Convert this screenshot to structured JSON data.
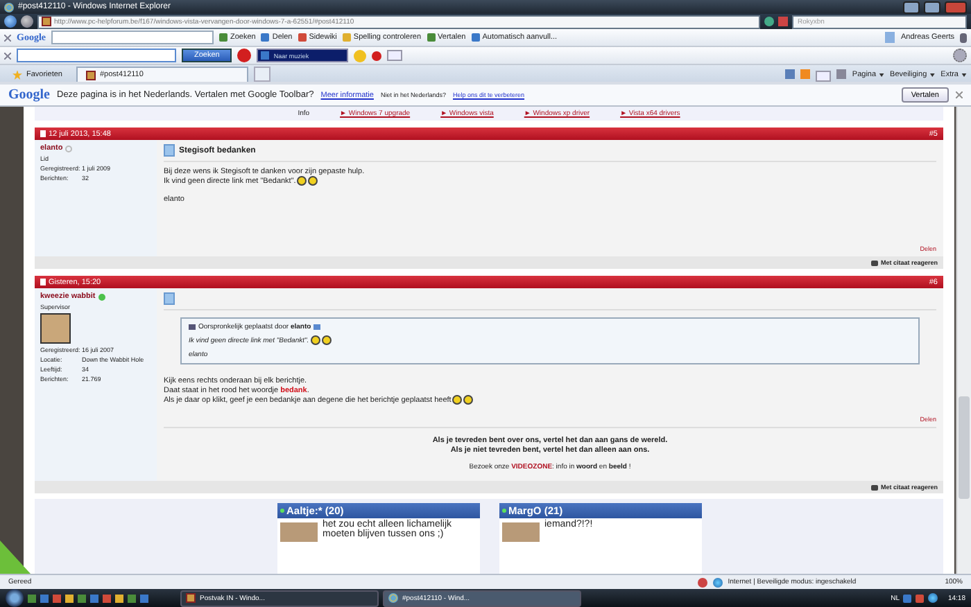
{
  "window": {
    "title": "#post412110 - Windows Internet Explorer"
  },
  "address_bar": {
    "url": "http://www.pc-helpforum.be/f167/windows-vista-vervangen-door-windows-7-a-62551/#post412110",
    "search_placeholder": "Rokyxbn"
  },
  "google_toolbar": {
    "logo": "Google",
    "items": [
      "Zoeken",
      "Delen",
      "Sidewiki",
      "Spelling controleren",
      "Vertalen",
      "Automatisch aanvull..."
    ],
    "account": "Andreas Geerts"
  },
  "second_toolbar": {
    "search_button": "Zoeken",
    "music_field": "Naar muziek"
  },
  "tabs": [
    {
      "label": "Favorieten",
      "kind": "favorites",
      "selected": false
    },
    {
      "label": "#post412110",
      "kind": "page",
      "selected": true
    }
  ],
  "command_bar": [
    "Pagina",
    "Beveiliging",
    "Extra"
  ],
  "translate_bar": {
    "logo": "Google",
    "message": "Deze pagina is in het Nederlands. Vertalen met Google Toolbar?",
    "more_link": "Meer informatie",
    "question": "Niet in het Nederlands?",
    "help_link": "Help ons dit te verbeteren",
    "button": "Vertalen"
  },
  "ad_links": {
    "label": "Info",
    "links": [
      "► Windows 7 upgrade",
      "► Windows vista",
      "► Windows xp driver",
      "► Vista x64 drivers"
    ]
  },
  "posts": [
    {
      "date": "12 juli 2013, 15:48",
      "number": "#5",
      "author": "elanto",
      "online": false,
      "role": "Lid",
      "avatar": false,
      "fields": [
        {
          "label": "Geregistreerd:",
          "value": "1 juli 2009"
        },
        {
          "label": "Berichten:",
          "value": "32"
        }
      ],
      "title": "Stegisoft bedanken",
      "lines": [
        {
          "text": "Bij deze wens ik Stegisoft te danken voor zijn gepaste hulp.",
          "smileys": false
        },
        {
          "text": "Ik vind geen directe link met \"Bedankt\".",
          "smileys": true
        }
      ],
      "signoff": "elanto",
      "share": "Delen",
      "reply": "Met citaat reageren"
    },
    {
      "date": "Gisteren, 15:20",
      "number": "#6",
      "author": "kweezie wabbit",
      "online": true,
      "role": "Supervisor",
      "avatar": true,
      "fields": [
        {
          "label": "Geregistreerd:",
          "value": "16 juli 2007"
        },
        {
          "label": "Locatie:",
          "value": "Down the Wabbit Hole"
        },
        {
          "label": "Leeftijd:",
          "value": "34"
        },
        {
          "label": "Berichten:",
          "value": "21.769"
        }
      ],
      "quote": {
        "prefix": "Oorspronkelijk geplaatst door",
        "author": "elanto",
        "text": "Ik vind geen directe link met \"Bedankt\".",
        "smileys": true,
        "signoff": "elanto"
      },
      "lines": [
        {
          "text": "Kijk eens rechts onderaan bij elk berichtje.",
          "smileys": false
        },
        {
          "text": "Daat staat in het rood het woordje **bedank**.",
          "smileys": false
        },
        {
          "text": "Als je daar op klikt, geef je een bedankje aan degene die het berichtje geplaatst heeft",
          "smileys": true
        }
      ],
      "share": "Delen",
      "signature": {
        "lines": [
          "Als je tevreden bent over ons, vertel het dan aan gans de wereld.",
          "Als je niet tevreden bent, vertel het dan alleen aan ons."
        ],
        "visit": "Bezoek onze **VIDEOZONE**: info in **woord** en **beeld** !"
      },
      "reply": "Met citaat reageren"
    }
  ],
  "shoutbox": [
    {
      "name": "Aaltje:* (20)",
      "online": true,
      "message": "het zou echt alleen lichamelijk moeten blijven tussen ons ;)"
    },
    {
      "name": "MargO (21)",
      "online": true,
      "message": "iemand?!?!"
    }
  ],
  "status_bar": {
    "text": "Gereed",
    "zone": "Internet | Beveiligde modus: ingeschakeld",
    "zoom": "100%"
  },
  "taskbar": {
    "windows": [
      {
        "label": "Postvak IN - Windo...",
        "selected": false
      },
      {
        "label": "#post412110 - Wind...",
        "selected": true
      }
    ],
    "language": "NL",
    "time": "14:18"
  }
}
